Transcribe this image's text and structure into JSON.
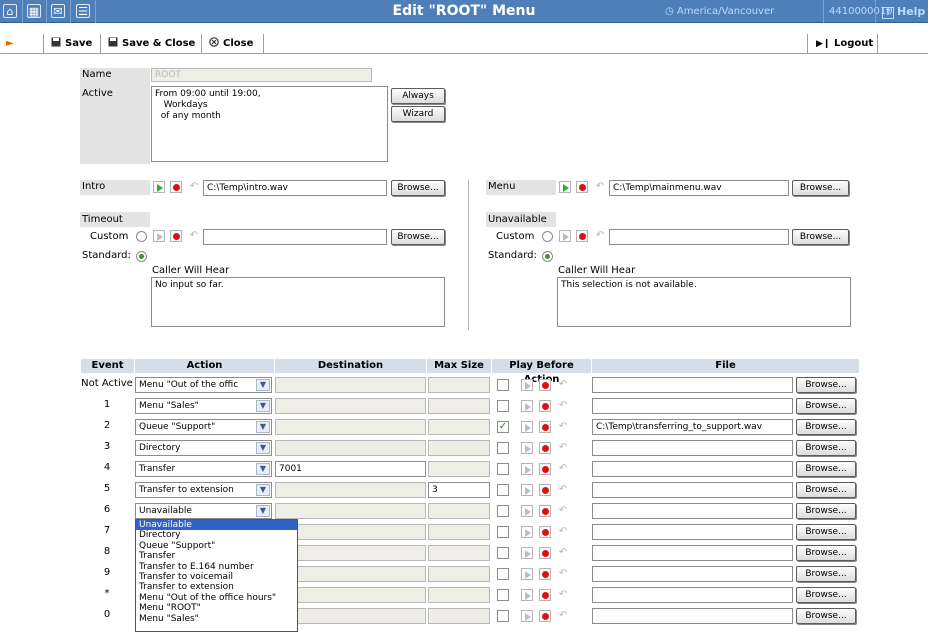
{
  "titlebar": {
    "title": "Edit \"ROOT\" Menu",
    "timezone": "America/Vancouver",
    "phone": "4410000010",
    "help": "Help",
    "icons": [
      "home-icon",
      "grid-icon",
      "mail-icon",
      "list-icon"
    ]
  },
  "toolbar": {
    "save": "Save",
    "save_close": "Save & Close",
    "close": "Close",
    "logout": "Logout"
  },
  "form": {
    "name_label": "Name",
    "name_value": "ROOT",
    "active_label": "Active",
    "active_text": "From 09:00 until 19:00,\n   Workdays\n  of any month",
    "always_btn": "Always",
    "wizard_btn": "Wizard",
    "intro_label": "Intro",
    "intro_file": "C:\\Temp\\intro.wav",
    "menu_label": "Menu",
    "menu_file": "C:\\Temp\\mainmenu.wav",
    "browse": "Browse...",
    "timeout_label": "Timeout",
    "unavailable_label": "Unavailable",
    "custom_label": "Custom",
    "standard_label": "Standard:",
    "caller_will_hear": "Caller Will Hear",
    "timeout_standard_text": "No input so far.",
    "unavailable_standard_text": "This selection is not available."
  },
  "table": {
    "headers": [
      "Event",
      "Action",
      "Destination",
      "Max Size",
      "Play Before Action",
      "File"
    ],
    "browse": "Browse...",
    "rows": [
      {
        "event": "Not Active",
        "action": "Menu \"Out of the offic",
        "destination": "",
        "max_size": "",
        "play": false,
        "file": ""
      },
      {
        "event": "1",
        "action": "Menu \"Sales\"",
        "destination": "",
        "max_size": "",
        "play": false,
        "file": ""
      },
      {
        "event": "2",
        "action": "Queue \"Support\"",
        "destination": "",
        "max_size": "",
        "play": true,
        "file": "C:\\Temp\\transferring_to_support.wav"
      },
      {
        "event": "3",
        "action": "Directory",
        "destination": "",
        "max_size": "",
        "play": false,
        "file": ""
      },
      {
        "event": "4",
        "action": "Transfer",
        "destination": "7001",
        "max_size": "",
        "play": false,
        "file": ""
      },
      {
        "event": "5",
        "action": "Transfer to extension",
        "destination": "",
        "max_size": "3",
        "play": false,
        "file": ""
      },
      {
        "event": "6",
        "action": "Unavailable",
        "destination": "",
        "max_size": "",
        "play": false,
        "file": ""
      },
      {
        "event": "7",
        "action": "",
        "destination": "",
        "max_size": "",
        "play": false,
        "file": ""
      },
      {
        "event": "8",
        "action": "",
        "destination": "",
        "max_size": "",
        "play": false,
        "file": ""
      },
      {
        "event": "9",
        "action": "",
        "destination": "",
        "max_size": "",
        "play": false,
        "file": ""
      },
      {
        "event": "*",
        "action": "",
        "destination": "",
        "max_size": "",
        "play": false,
        "file": ""
      },
      {
        "event": "0",
        "action": "",
        "destination": "",
        "max_size": "",
        "play": false,
        "file": ""
      }
    ]
  },
  "dropdown": {
    "selected": "Unavailable",
    "options": [
      "Unavailable",
      "Directory",
      "Queue \"Support\"",
      "Transfer",
      "Transfer to E.164 number",
      "Transfer to voicemail",
      "Transfer to extension",
      "Menu \"Out of the office hours\"",
      "Menu \"ROOT\"",
      "Menu \"Sales\""
    ]
  }
}
